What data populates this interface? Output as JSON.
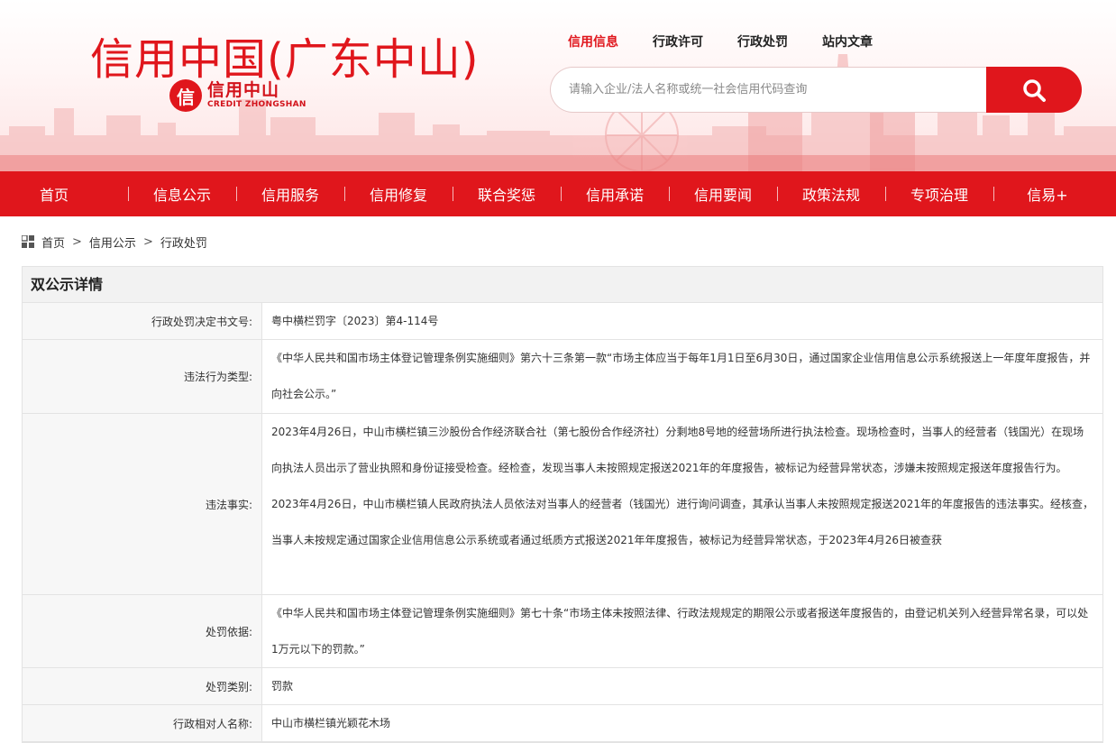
{
  "site": {
    "title": "信用中国(广东中山)",
    "logo_mark": "信",
    "logo_cn": "信用中山",
    "logo_en": "CREDIT ZHONGSHAN"
  },
  "top_links": [
    {
      "label": "信用信息",
      "active": true
    },
    {
      "label": "行政许可",
      "active": false
    },
    {
      "label": "行政处罚",
      "active": false
    },
    {
      "label": "站内文章",
      "active": false
    }
  ],
  "search": {
    "placeholder": "请输入企业/法人名称或统一社会信用代码查询",
    "icon": "search-icon"
  },
  "nav": [
    "首页",
    "信息公示",
    "信用服务",
    "信用修复",
    "联合奖惩",
    "信用承诺",
    "信用要闻",
    "政策法规",
    "专项治理",
    "信易+"
  ],
  "breadcrumb": [
    "首页",
    "信用公示",
    "行政处罚"
  ],
  "detail": {
    "title": "双公示详情",
    "rows": [
      {
        "label": "行政处罚决定书文号:",
        "value": "粤中横栏罚字〔2023〕第4-114号"
      },
      {
        "label": "违法行为类型:",
        "value": "《中华人民共和国市场主体登记管理条例实施细则》第六十三条第一款“市场主体应当于每年1月1日至6月30日，通过国家企业信用信息公示系统报送上一年度年度报告，并向社会公示。”"
      },
      {
        "label": "违法事实:",
        "value": "2023年4月26日，中山市横栏镇三沙股份合作经济联合社（第七股份合作经济社）分剩地8号地的经营场所进行执法检查。现场检查时，当事人的经营者（钱国光）在现场向执法人员出示了营业执照和身份证接受检查。经检查，发现当事人未按照规定报送2021年的年度报告，被标记为经营异常状态，涉嫌未按照规定报送年度报告行为。2023年4月26日，中山市横栏镇人民政府执法人员依法对当事人的经营者（钱国光）进行询问调查，其承认当事人未按照规定报送2021年的年度报告的违法事实。经核查，当事人未按规定通过国家企业信用信息公示系统或者通过纸质方式报送2021年年度报告，被标记为经营异常状态，于2023年4月26日被查获"
      },
      {
        "label": "处罚依据:",
        "value": "《中华人民共和国市场主体登记管理条例实施细则》第七十条“市场主体未按照法律、行政法规规定的期限公示或者报送年度报告的，由登记机关列入经营异常名录，可以处1万元以下的罚款。”"
      },
      {
        "label": "处罚类别:",
        "value": "罚款"
      },
      {
        "label": "行政相对人名称:",
        "value": "中山市横栏镇光颖花木场"
      }
    ]
  },
  "colors": {
    "brand_red": "#e0161c",
    "label_bg": "#f7f7f7",
    "title_bg": "#f2f2f2"
  }
}
